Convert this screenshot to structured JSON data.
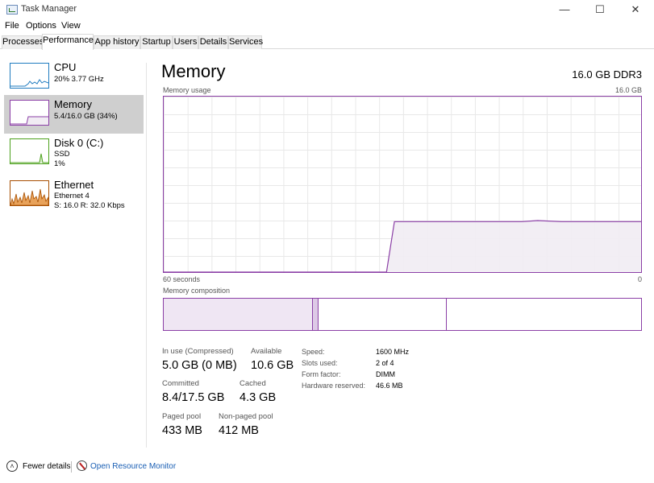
{
  "window": {
    "title": "Task Manager",
    "minimize_glyph": "—",
    "maximize_glyph": "☐",
    "close_glyph": "✕"
  },
  "menu": [
    "File",
    "Options",
    "View"
  ],
  "tabs": [
    "Processes",
    "Performance",
    "App history",
    "Startup",
    "Users",
    "Details",
    "Services"
  ],
  "active_tab": "Performance",
  "sidebar": [
    {
      "name": "CPU",
      "line1": "20%  3.77 GHz",
      "line2": "",
      "color": "#1f7bbf"
    },
    {
      "name": "Memory",
      "line1": "5.4/16.0 GB (34%)",
      "line2": "",
      "color": "#8b3fa6"
    },
    {
      "name": "Disk 0 (C:)",
      "line1": "SSD",
      "line2": "1%",
      "color": "#4da11d"
    },
    {
      "name": "Ethernet",
      "line1": "Ethernet 4",
      "line2": "S: 16.0  R: 32.0 Kbps",
      "color": "#a74f01"
    }
  ],
  "main": {
    "title": "Memory",
    "spec": "16.0 GB DDR3",
    "usage_label": "Memory usage",
    "usage_max": "16.0 GB",
    "time_left": "60 seconds",
    "time_right": "0",
    "composition_label": "Memory composition"
  },
  "stats": {
    "in_use_label": "In use (Compressed)",
    "in_use_value": "5.0 GB (0 MB)",
    "available_label": "Available",
    "available_value": "10.6 GB",
    "committed_label": "Committed",
    "committed_value": "8.4/17.5 GB",
    "cached_label": "Cached",
    "cached_value": "4.3 GB",
    "paged_label": "Paged pool",
    "paged_value": "433 MB",
    "nonpaged_label": "Non-paged pool",
    "nonpaged_value": "412 MB"
  },
  "hardware": [
    {
      "label": "Speed:",
      "value": "1600 MHz"
    },
    {
      "label": "Slots used:",
      "value": "2 of 4"
    },
    {
      "label": "Form factor:",
      "value": "DIMM"
    },
    {
      "label": "Hardware reserved:",
      "value": "46.6 MB"
    }
  ],
  "footer": {
    "fewer_details": "Fewer details",
    "open_resource_monitor": "Open Resource Monitor"
  },
  "colors": {
    "memory_accent": "#8b3fa6",
    "memory_fill": "#f1ecf3"
  },
  "chart_data": {
    "type": "area",
    "title": "Memory usage",
    "x_unit": "seconds ago",
    "xlim": [
      60,
      0
    ],
    "ylim": [
      0,
      16.0
    ],
    "series": [
      {
        "x": [
          60,
          32,
          31,
          28,
          25,
          22,
          18,
          15,
          13,
          10,
          7,
          4,
          0
        ],
        "values": [
          0,
          0,
          4.6,
          4.6,
          4.6,
          4.6,
          4.6,
          4.6,
          4.7,
          4.6,
          4.6,
          4.6,
          4.6
        ]
      }
    ]
  },
  "composition": {
    "in_use": 5.0,
    "modified": 0.2,
    "standby": 4.3,
    "free": 6.5,
    "total": 16.0
  }
}
